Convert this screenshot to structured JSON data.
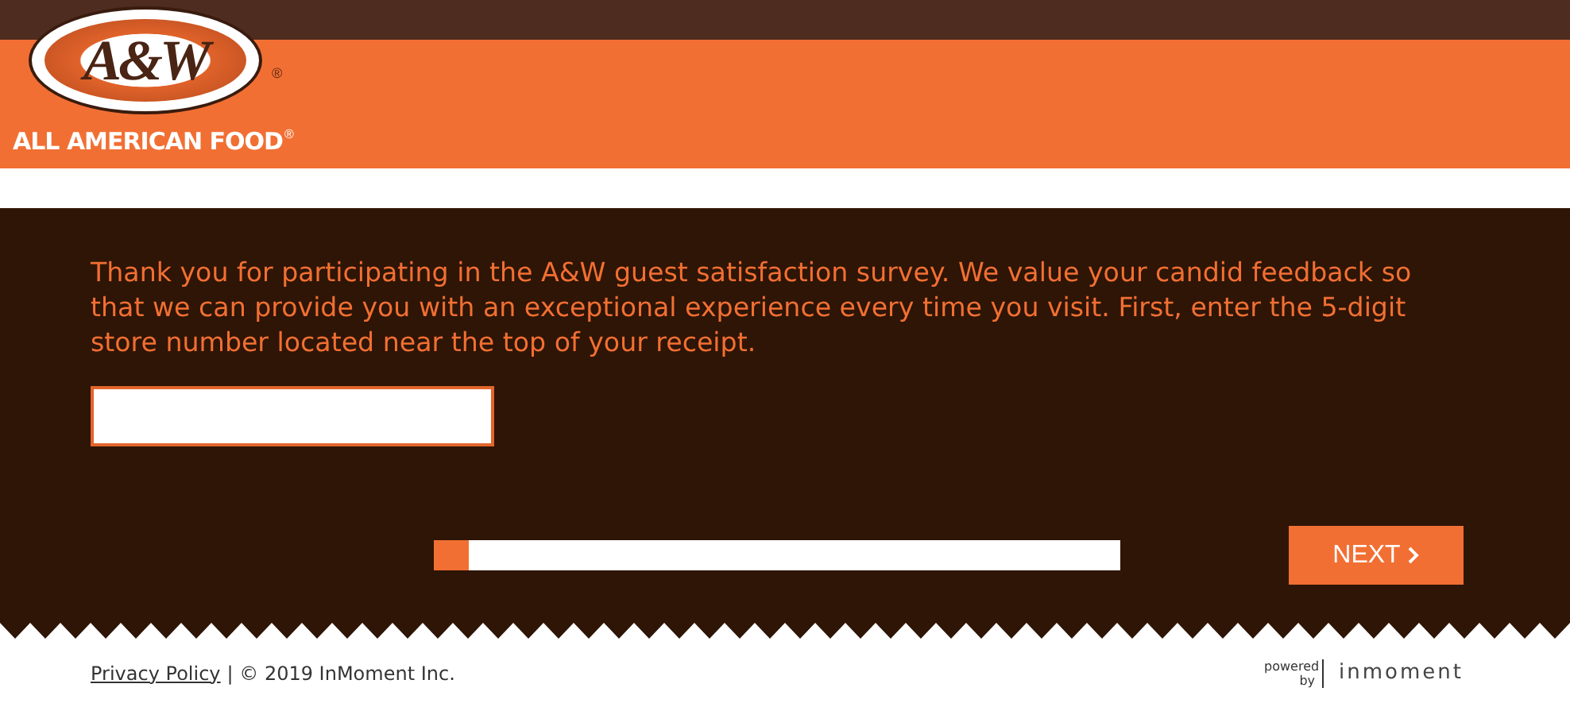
{
  "logo": {
    "mark": "A&W",
    "mark_registered": "®",
    "tagline": "ALL AMERICAN FOOD",
    "tagline_registered": "®"
  },
  "intro": "Thank you for participating in the A&W guest satisfaction survey. We value your candid feedback so that we can provide you with an exceptional experience every time you visit. First, enter the 5-digit store number located near the top of your receipt.",
  "store_field": {
    "focused": true
  },
  "progress": {
    "level": 0.05
  },
  "next_button": {
    "label": "NEXT"
  },
  "footer": {
    "link": "Privacy Policy",
    "copyright": "| © 2019 InMoment Inc.",
    "powered_by": "powered by",
    "brand": "inmoment"
  }
}
